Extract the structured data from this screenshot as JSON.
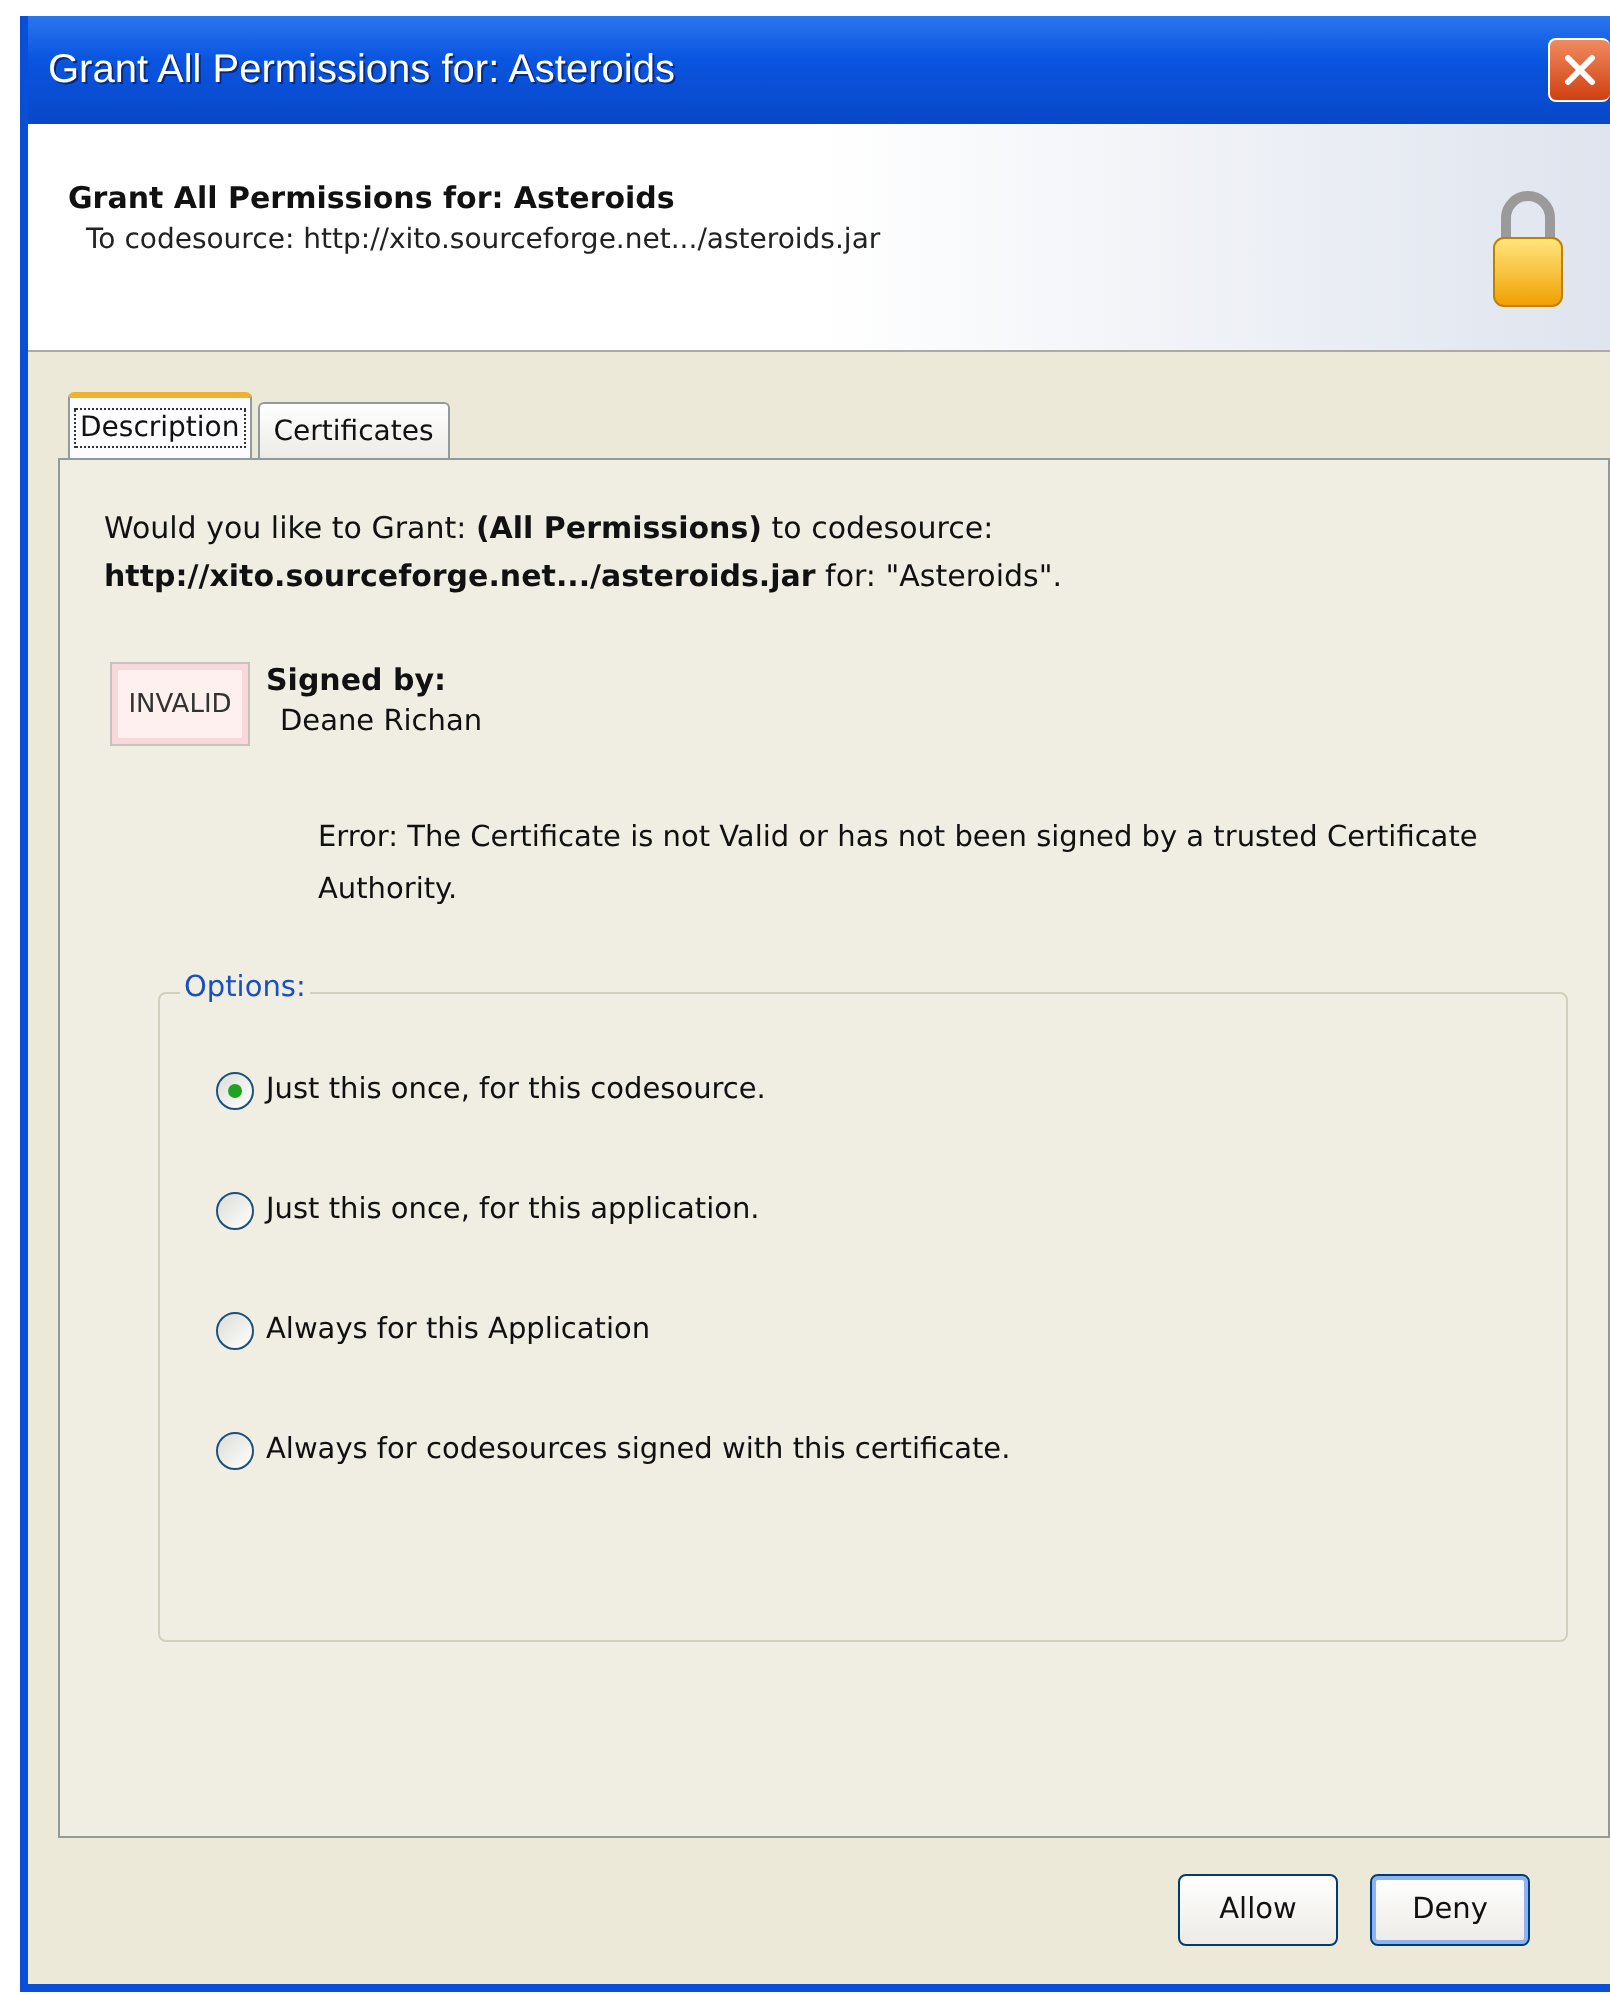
{
  "window": {
    "title": "Grant All Permissions for: Asteroids"
  },
  "header": {
    "title": "Grant All Permissions for: Asteroids",
    "subtitle": "To codesource: http://xito.sourceforge.net.../asteroids.jar"
  },
  "tabs": [
    {
      "label": "Description",
      "selected": true
    },
    {
      "label": "Certificates",
      "selected": false
    }
  ],
  "description": {
    "message": "Would you like to Grant: **(All Permissions)** to codesource: **http://xito.sourceforge.net.../asteroids.jar** for: \"Asteroids\".",
    "badge": "INVALID",
    "signed_by_label": "Signed by:",
    "signer": "Deane Richan",
    "error": "Error: The Certificate is not Valid or has not been signed by a trusted Certificate Authority."
  },
  "options": {
    "legend": "Options:",
    "items": [
      {
        "label": "Just this once, for this codesource.",
        "selected": true
      },
      {
        "label": "Just this once, for this application.",
        "selected": false
      },
      {
        "label": "Always for this Application",
        "selected": false
      },
      {
        "label": "Always for codesources signed with this certificate.",
        "selected": false
      }
    ]
  },
  "buttons": [
    "Allow",
    "Deny"
  ]
}
